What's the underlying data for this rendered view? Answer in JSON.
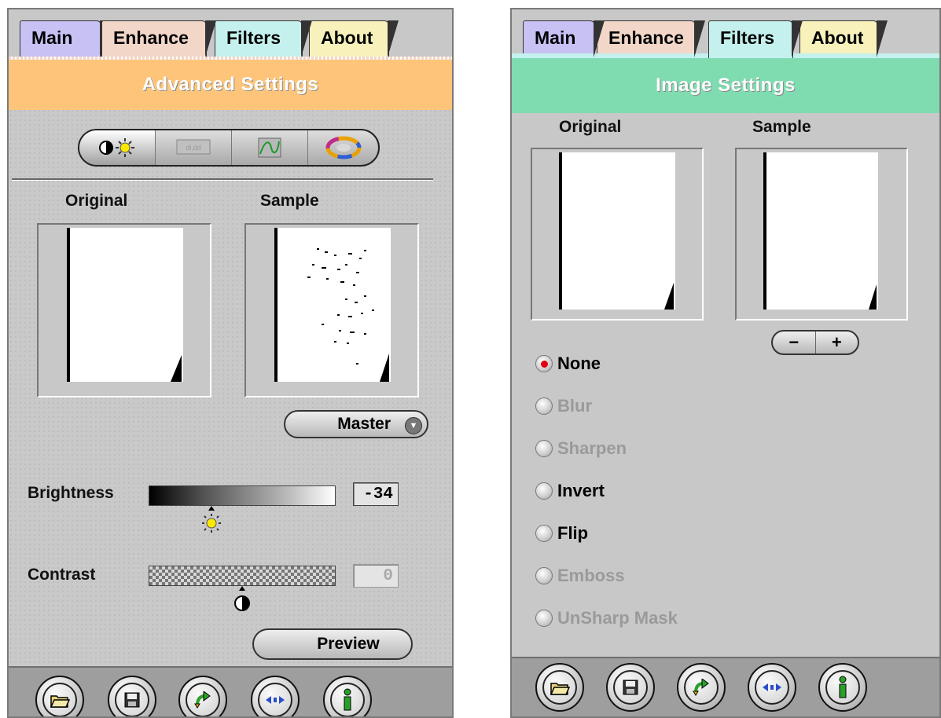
{
  "left": {
    "tabs": [
      {
        "label": "Main",
        "color": "#c7c1f4"
      },
      {
        "label": "Enhance",
        "color": "#f2d6c8"
      },
      {
        "label": "Filters",
        "color": "#c4f1ee"
      },
      {
        "label": "About",
        "color": "#f8f1bc"
      }
    ],
    "banner": {
      "title": "Advanced Settings",
      "color": "#fec57a"
    },
    "mode_buttons": [
      {
        "icon": "brightness-contrast-icon",
        "active": true
      },
      {
        "icon": "levels-icon",
        "active": false
      },
      {
        "icon": "curves-icon",
        "active": false
      },
      {
        "icon": "color-wheel-icon",
        "active": false
      }
    ],
    "histograms": {
      "original_label": "Original",
      "sample_label": "Sample"
    },
    "channel_select": {
      "value": "Master"
    },
    "brightness": {
      "label": "Brightness",
      "value": "-34"
    },
    "contrast": {
      "label": "Contrast",
      "value": "0"
    },
    "preview_label": "Preview",
    "toolbar": [
      "open-folder-icon",
      "save-disk-icon",
      "undo-arrow-icon",
      "compare-icon",
      "info-icon"
    ]
  },
  "right": {
    "tabs": [
      {
        "label": "Main",
        "color": "#c7c1f4"
      },
      {
        "label": "Enhance",
        "color": "#f2d6c8"
      },
      {
        "label": "Filters",
        "color": "#c4f1ee"
      },
      {
        "label": "About",
        "color": "#f8f1bc"
      }
    ],
    "banner": {
      "title": "Image Settings",
      "color": "#7fdcb1"
    },
    "histograms": {
      "original_label": "Original",
      "sample_label": "Sample"
    },
    "zoom": {
      "minus": "−",
      "plus": "+"
    },
    "filters": [
      {
        "label": "None",
        "selected": true,
        "enabled": true
      },
      {
        "label": "Blur",
        "selected": false,
        "enabled": false
      },
      {
        "label": "Sharpen",
        "selected": false,
        "enabled": false
      },
      {
        "label": "Invert",
        "selected": false,
        "enabled": true
      },
      {
        "label": "Flip",
        "selected": false,
        "enabled": true
      },
      {
        "label": "Emboss",
        "selected": false,
        "enabled": false
      },
      {
        "label": "UnSharp Mask",
        "selected": false,
        "enabled": false
      }
    ],
    "toolbar": [
      "open-folder-icon",
      "save-disk-icon",
      "undo-arrow-icon",
      "compare-icon",
      "info-icon"
    ]
  }
}
